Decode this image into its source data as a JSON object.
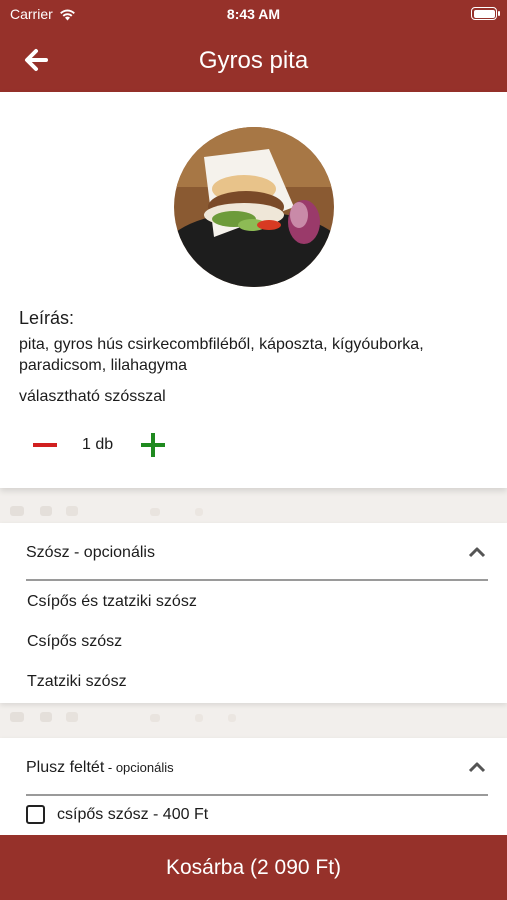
{
  "status_bar": {
    "carrier": "Carrier",
    "time": "8:43 AM",
    "wifi_icon": "wifi-icon",
    "battery_icon": "battery-icon"
  },
  "nav": {
    "title": "Gyros pita",
    "back_icon": "arrow-left-icon"
  },
  "product": {
    "image_alt": "gyros pita food photo",
    "description_heading": "Leírás:",
    "description": "pita, gyros hús csirkecombfiléből, káposzta, kígyóuborka, paradicsom, lilahagyma",
    "description_extra": "választható szósszal",
    "quantity": "1 db",
    "minus_icon": "minus-icon",
    "plus_icon": "plus-icon"
  },
  "sections": [
    {
      "title": "Szósz - opcionális",
      "chevron_icon": "chevron-up-icon",
      "options": [
        "Csípős és tzatziki szósz",
        "Csípős szósz",
        "Tzatziki szósz"
      ]
    },
    {
      "title": "Plusz feltét",
      "title_suffix": " - opcionális",
      "chevron_icon": "chevron-up-icon",
      "checkbox_options": [
        {
          "label": "csípős szósz - 400 Ft",
          "checked": false
        }
      ]
    }
  ],
  "cart_button": {
    "label": "Kosárba (2 090 Ft)"
  },
  "colors": {
    "brand": "#96312a",
    "minus": "#d11f1f",
    "plus": "#1f8a1f"
  }
}
